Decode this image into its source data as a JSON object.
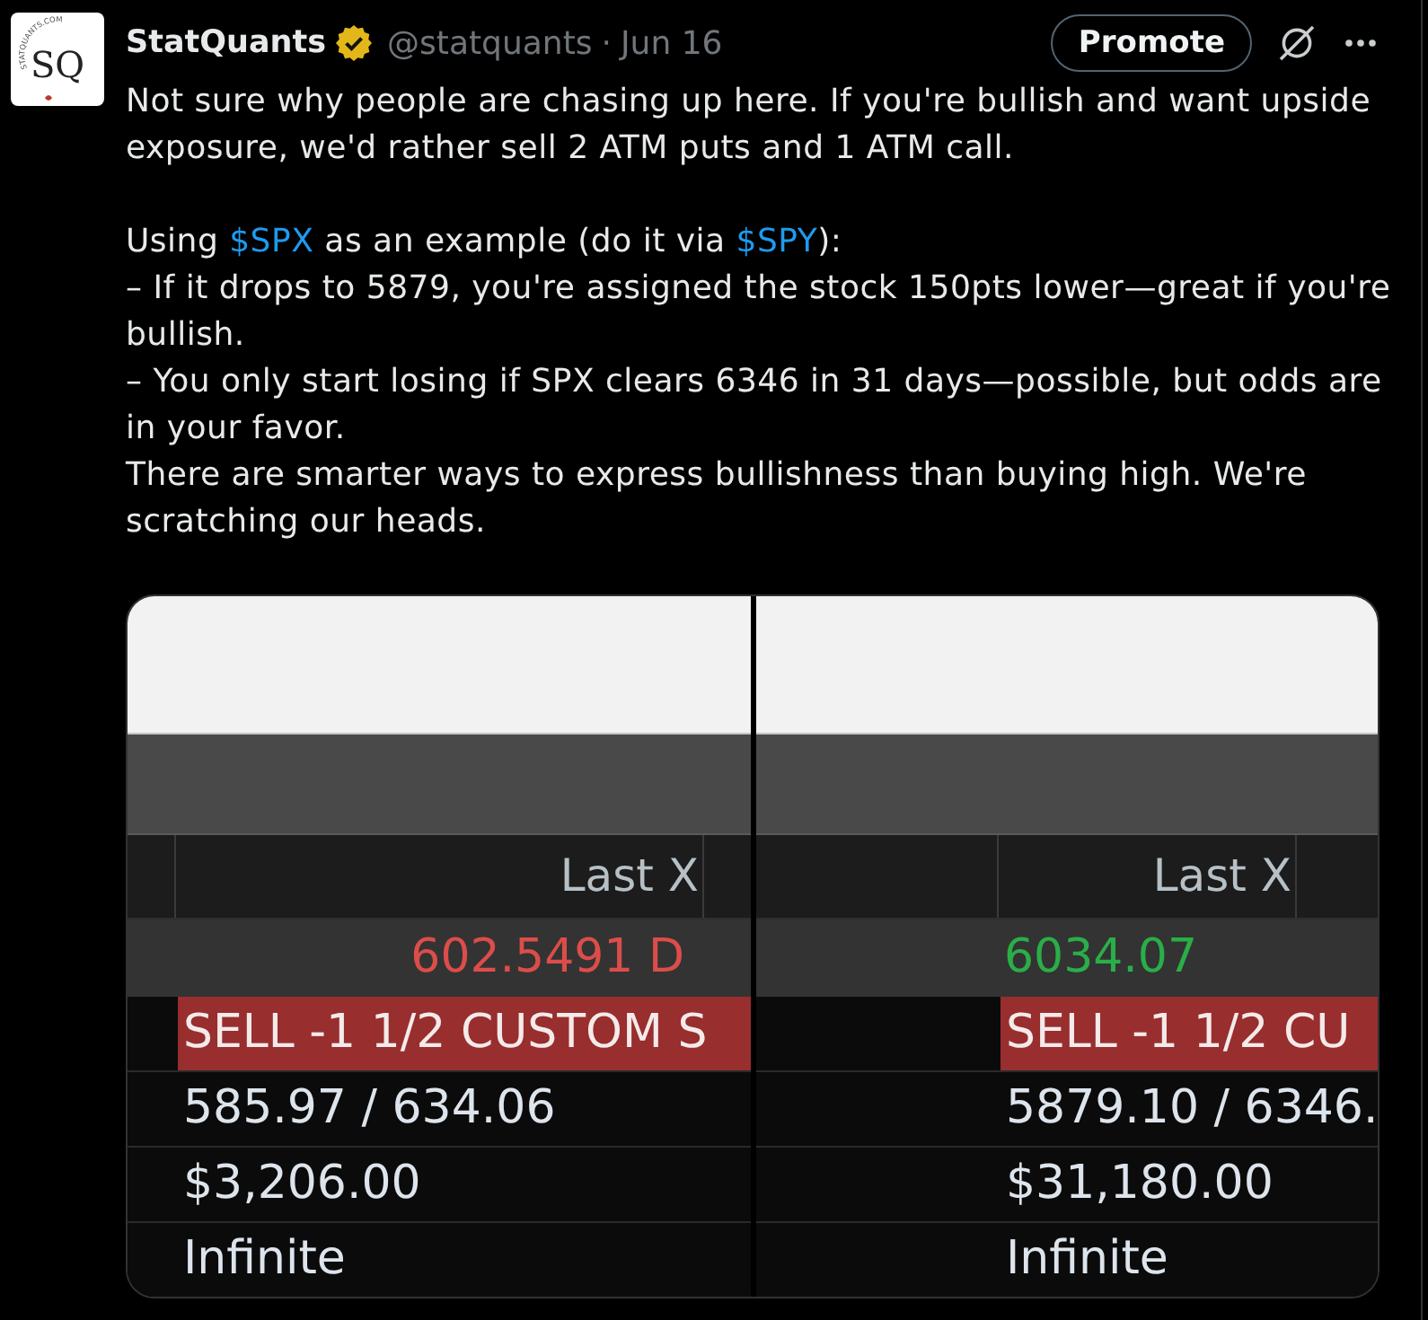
{
  "post": {
    "avatar": {
      "monogram": "SQ",
      "ring_text": "STATQUANTS.COM"
    },
    "author": {
      "name": "StatQuants",
      "verified": true,
      "handle": "@statquants",
      "separator": "·",
      "date": "Jun 16"
    },
    "promote_button": "Promote",
    "body": [
      {
        "lines": [
          [
            {
              "text": "Not sure why people are chasing up here. If you're bullish and want upside exposure, we'd rather sell 2 ATM puts and 1 ATM call."
            }
          ]
        ]
      },
      {
        "lines": [
          [
            {
              "text": "Using "
            },
            {
              "text": "$SPX",
              "kind": "cashtag"
            },
            {
              "text": " as an example (do it via "
            },
            {
              "text": "$SPY",
              "kind": "cashtag"
            },
            {
              "text": "):"
            }
          ],
          [
            {
              "text": "– If it drops to 5879, you're assigned the stock 150pts lower—great if you're bullish."
            }
          ],
          [
            {
              "text": "– You only start losing if SPX clears 6346 in 31 days—possible, but odds are in your favor."
            }
          ],
          [
            {
              "text": "There are smarter ways to express bullishness than buying high. We're scratching our heads."
            }
          ]
        ]
      }
    ]
  },
  "media": {
    "panels": [
      {
        "kind": "left",
        "header": "Last X",
        "quote": {
          "text": "602.5491 D",
          "color": "#dc4d4a"
        },
        "order": "SELL -1 1/2 CUSTOM S",
        "rows": [
          "585.97 / 634.06",
          "$3,206.00",
          "Infinite"
        ]
      },
      {
        "kind": "right",
        "header": "Last X",
        "quote": {
          "text": "6034.07",
          "color": "#2aae48"
        },
        "order": "SELL -1 1/2 CU",
        "rows": [
          "5879.10 / 6346.",
          "$31,180.00",
          "Infinite"
        ]
      }
    ]
  }
}
